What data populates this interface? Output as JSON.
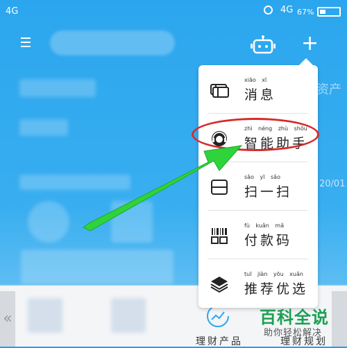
{
  "status_bar": {
    "signal_left": "4G",
    "signal_right": "4G",
    "battery_percent": "67%"
  },
  "menu": {
    "items": [
      {
        "id": "messages",
        "label": "消息",
        "pinyin": "xiāo xī",
        "icon": "ticket-icon"
      },
      {
        "id": "assistant",
        "label": "智能助手",
        "pinyin": "zhì néng zhù shǒu",
        "icon": "headset-icon"
      },
      {
        "id": "scan",
        "label": "扫一扫",
        "pinyin": "sǎo yī sǎo",
        "icon": "scan-icon"
      },
      {
        "id": "paycode",
        "label": "付款码",
        "pinyin": "fù kuǎn mǎ",
        "icon": "paycode-icon"
      },
      {
        "id": "recommend",
        "label": "推荐优选",
        "pinyin": "tuī jiàn yōu xuǎn",
        "icon": "layers-icon"
      }
    ]
  },
  "background_hints": {
    "asset_fragment": "资产",
    "date_fragment": "20/01"
  },
  "bottom": {
    "left_arrow": "«",
    "label_left": "理财产品",
    "label_right": "理财规划"
  },
  "watermark": {
    "title": "百科全说",
    "subtitle": "助你轻松解决"
  },
  "colors": {
    "primary_blue": "#2ba6ee",
    "highlight_red": "#d62b2b",
    "arrow_green": "#2fd33c",
    "watermark_green": "#1aa053"
  }
}
